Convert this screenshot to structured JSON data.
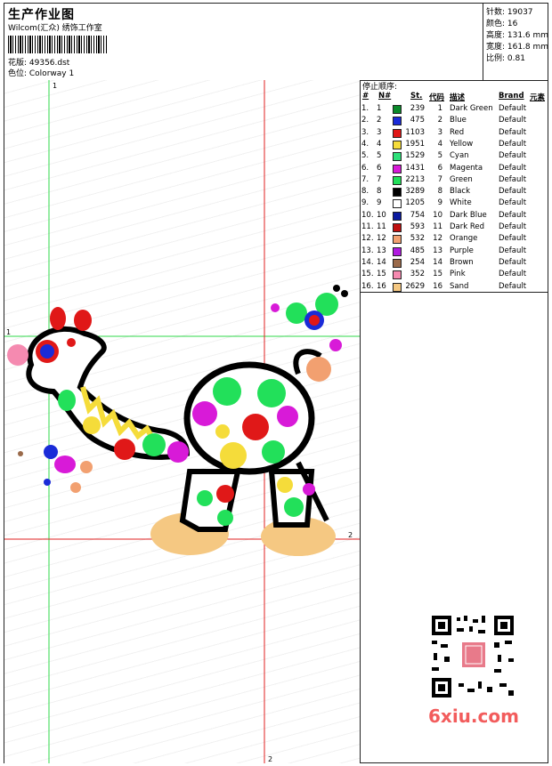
{
  "header": {
    "title": "生产作业图",
    "subtitle": "Wilcom(汇众) 绣饰工作室",
    "file_label": "花版: 49356.dst",
    "colorway_label": "色位: Colorway 1"
  },
  "stats": {
    "stitches": "针数: 19037",
    "colors": "颜色: 16",
    "height": "高度: 131.6 mm",
    "width": "宽度: 161.8 mm",
    "scale": "比例: 0.81"
  },
  "stop_sequence": {
    "title": "停止顺序:",
    "headers": [
      "#",
      "N#",
      "St.",
      "代码",
      "描述",
      "Brand",
      "元素"
    ],
    "rows": [
      {
        "idx": "1.",
        "n": "1",
        "st": "239",
        "code": "1",
        "desc": "Dark Green",
        "brand": "Default",
        "color": "#0a8a2a"
      },
      {
        "idx": "2.",
        "n": "2",
        "st": "475",
        "code": "2",
        "desc": "Blue",
        "brand": "Default",
        "color": "#1a2bd8"
      },
      {
        "idx": "3.",
        "n": "3",
        "st": "1103",
        "code": "3",
        "desc": "Red",
        "brand": "Default",
        "color": "#e01818"
      },
      {
        "idx": "4.",
        "n": "4",
        "st": "1951",
        "code": "4",
        "desc": "Yellow",
        "brand": "Default",
        "color": "#f5dc3a"
      },
      {
        "idx": "5.",
        "n": "5",
        "st": "1529",
        "code": "5",
        "desc": "Cyan",
        "brand": "Default",
        "color": "#2ee07a"
      },
      {
        "idx": "6.",
        "n": "6",
        "st": "1431",
        "code": "6",
        "desc": "Magenta",
        "brand": "Default",
        "color": "#d81ad8"
      },
      {
        "idx": "7.",
        "n": "7",
        "st": "2213",
        "code": "7",
        "desc": "Green",
        "brand": "Default",
        "color": "#22e05a"
      },
      {
        "idx": "8.",
        "n": "8",
        "st": "3289",
        "code": "8",
        "desc": "Black",
        "brand": "Default",
        "color": "#000000"
      },
      {
        "idx": "9.",
        "n": "9",
        "st": "1205",
        "code": "9",
        "desc": "White",
        "brand": "Default",
        "color": "#ffffff"
      },
      {
        "idx": "10.",
        "n": "10",
        "st": "754",
        "code": "10",
        "desc": "Dark Blue",
        "brand": "Default",
        "color": "#0a1aa0"
      },
      {
        "idx": "11.",
        "n": "11",
        "st": "593",
        "code": "11",
        "desc": "Dark Red",
        "brand": "Default",
        "color": "#c01010"
      },
      {
        "idx": "12.",
        "n": "12",
        "st": "532",
        "code": "12",
        "desc": "Orange",
        "brand": "Default",
        "color": "#f2a070"
      },
      {
        "idx": "13.",
        "n": "13",
        "st": "485",
        "code": "13",
        "desc": "Purple",
        "brand": "Default",
        "color": "#b01ae0"
      },
      {
        "idx": "14.",
        "n": "14",
        "st": "254",
        "code": "14",
        "desc": "Brown",
        "brand": "Default",
        "color": "#9a6a4a"
      },
      {
        "idx": "15.",
        "n": "15",
        "st": "352",
        "code": "15",
        "desc": "Pink",
        "brand": "Default",
        "color": "#f58ab0"
      },
      {
        "idx": "16.",
        "n": "16",
        "st": "2629",
        "code": "16",
        "desc": "Sand",
        "brand": "Default",
        "color": "#f5c882"
      }
    ]
  },
  "markers": {
    "one": "1",
    "two": "2"
  },
  "watermark": "6xiu.com"
}
